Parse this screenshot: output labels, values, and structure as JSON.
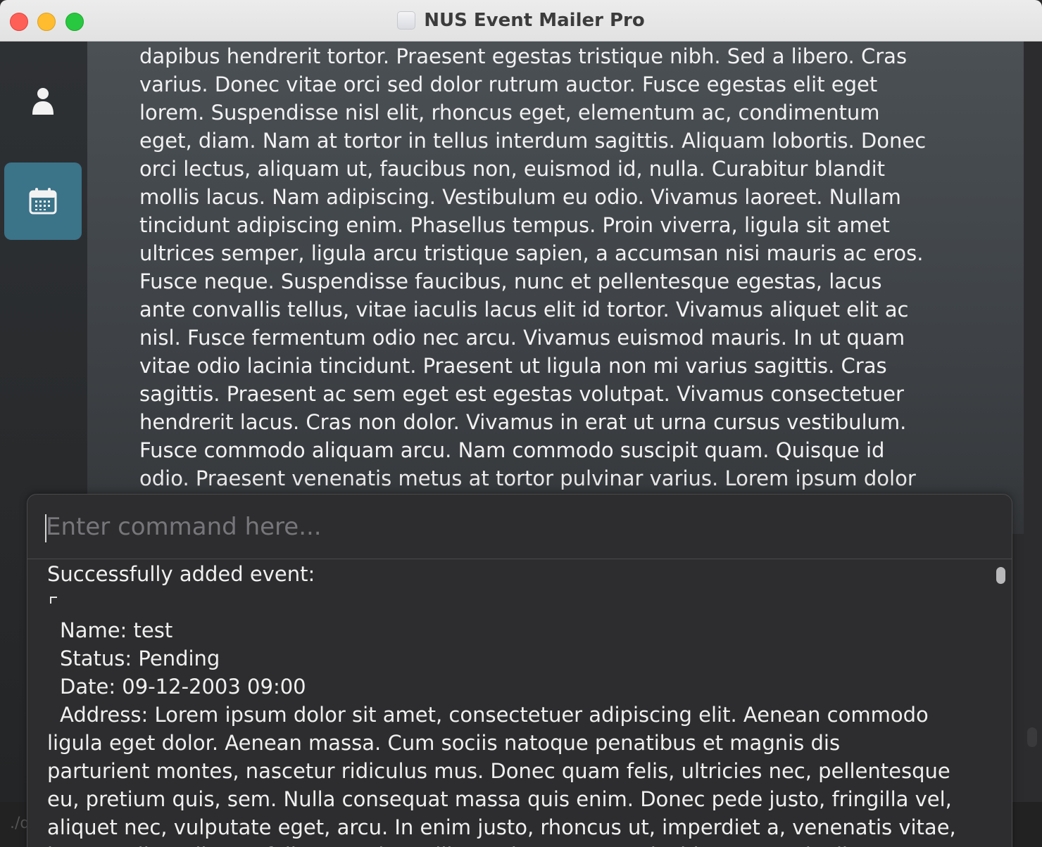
{
  "window": {
    "title": "NUS Event Mailer Pro"
  },
  "sidebar": {
    "items": [
      {
        "name": "persons",
        "icon": "person-icon",
        "active": false
      },
      {
        "name": "events",
        "icon": "calendar-icon",
        "active": true
      }
    ]
  },
  "content": {
    "description_lines": [
      "dapibus hendrerit tortor. Praesent egestas tristique nibh. Sed a libero. Cras",
      "varius. Donec vitae orci sed dolor rutrum auctor. Fusce egestas elit eget",
      "lorem. Suspendisse nisl elit, rhoncus eget, elementum ac, condimentum",
      "eget, diam. Nam at tortor in tellus interdum sagittis. Aliquam lobortis. Donec",
      "orci lectus, aliquam ut, faucibus non, euismod id, nulla. Curabitur blandit",
      "mollis lacus. Nam adipiscing. Vestibulum eu odio. Vivamus laoreet. Nullam",
      "tincidunt adipiscing enim. Phasellus tempus. Proin viverra, ligula sit amet",
      "ultrices semper, ligula arcu tristique sapien, a accumsan nisi mauris ac eros.",
      "Fusce neque. Suspendisse faucibus, nunc et pellentesque egestas, lacus",
      "ante convallis tellus, vitae iaculis lacus elit id tortor. Vivamus aliquet elit ac",
      "nisl. Fusce fermentum odio nec arcu. Vivamus euismod mauris. In ut quam",
      "vitae odio lacinia tincidunt. Praesent ut ligula non mi varius sagittis. Cras",
      "sagittis. Praesent ac sem eget est egestas volutpat. Vivamus consectetuer",
      "hendrerit lacus. Cras non dolor. Vivamus in erat ut urna cursus vestibulum.",
      "Fusce commodo aliquam arcu. Nam commodo suscipit quam. Quisque id",
      "odio. Praesent venenatis metus at tortor pulvinar varius. Lorem ipsum dolor"
    ]
  },
  "command": {
    "placeholder": "Enter command here...",
    "value": ""
  },
  "result": {
    "heading": "Successfully added event:",
    "name": "Name: test",
    "status": "Status: Pending",
    "date": "Date: 09-12-2003 09:00",
    "address_first": "Address: Lorem ipsum dolor sit amet, consectetuer adipiscing elit. Aenean commodo",
    "address_lines": [
      "ligula eget dolor. Aenean massa. Cum sociis natoque penatibus et magnis dis",
      "parturient montes, nascetur ridiculus mus. Donec quam felis, ultricies nec, pellentesque",
      "eu, pretium quis, sem. Nulla consequat massa quis enim. Donec pede justo, fringilla vel,",
      "aliquet nec, vulputate eget, arcu. In enim justo, rhoncus ut, imperdiet a, venenatis vitae,",
      "justo. Nullam dictum felis eu pede mollis pretium. Integer tincidunt. Cras dapibus."
    ]
  },
  "status_bar": {
    "path_text": "./d"
  },
  "colors": {
    "accent": "#3b7389",
    "panel": "#2d2d2f",
    "content_bg": "#4a5054"
  }
}
